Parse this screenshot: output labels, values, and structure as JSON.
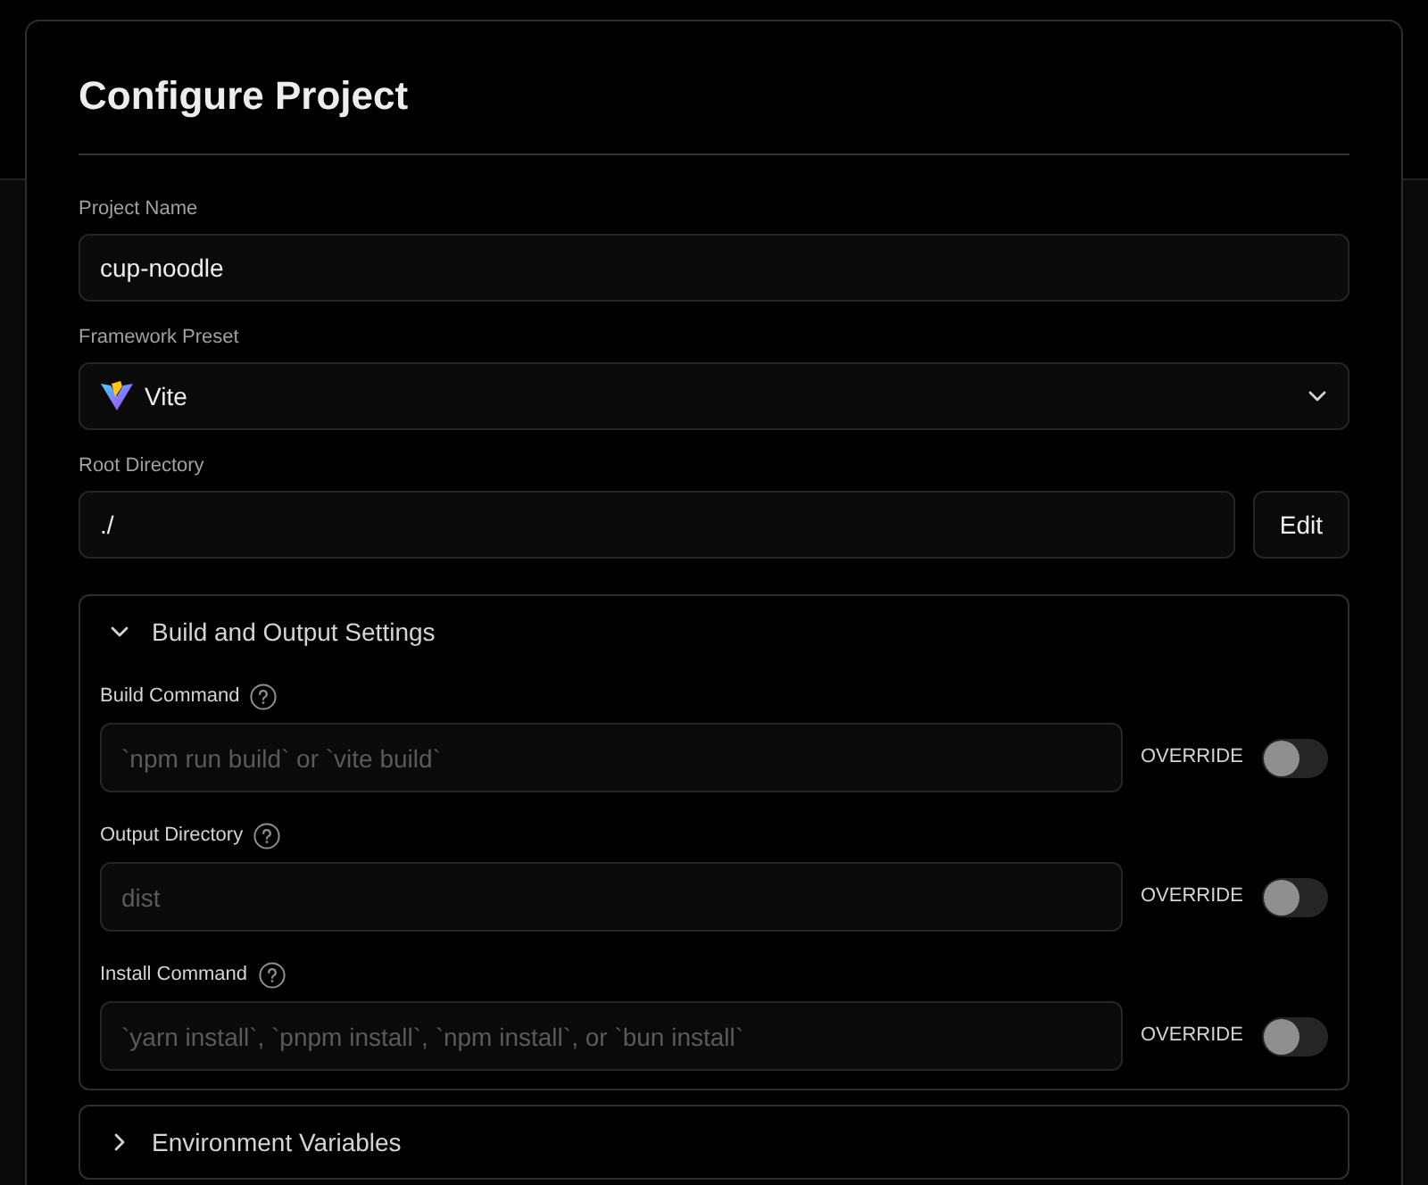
{
  "title": "Configure Project",
  "fields": [
    {
      "label": "Project Name",
      "kind": "text",
      "value": "cup-noodle"
    },
    {
      "label": "Framework Preset",
      "kind": "select",
      "value": "Vite"
    },
    {
      "label": "Root Directory",
      "kind": "text-button",
      "value": "./",
      "button": "Edit"
    }
  ],
  "sections": [
    {
      "title": "Build and Output Settings",
      "expanded": true,
      "settings": [
        {
          "label": "Build Command",
          "placeholder": "`npm run build` or `vite build`",
          "toggle_label": "OVERRIDE",
          "on": false
        },
        {
          "label": "Output Directory",
          "placeholder": "dist",
          "toggle_label": "OVERRIDE",
          "on": false
        },
        {
          "label": "Install Command",
          "placeholder": "`yarn install`, `pnpm install`, `npm install`, or `bun install`",
          "toggle_label": "OVERRIDE",
          "on": false
        }
      ]
    },
    {
      "title": "Environment Variables",
      "expanded": false
    }
  ]
}
